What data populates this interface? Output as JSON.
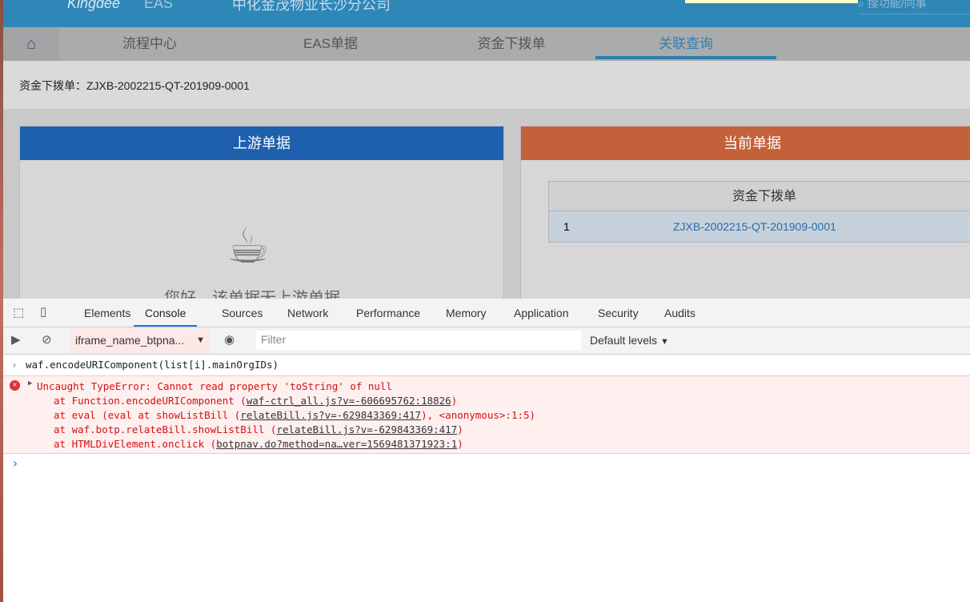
{
  "header": {
    "logo": "Kingdee",
    "product": "EAS",
    "org": "中化金茂物业长沙分公司",
    "search_placeholder": "搜功能/同事"
  },
  "nav": {
    "home": "⌂",
    "tabs": [
      "流程中心",
      "EAS单据",
      "资金下拨单",
      "关联查询"
    ],
    "active": 3
  },
  "breadcrumb": "资金下拨单：ZJXB-2002215-QT-201909-0001",
  "upstream": {
    "title": "上游单据",
    "empty_text": "您好，该单据无上游单据",
    "color": "#1e5fae"
  },
  "current": {
    "title": "当前单据",
    "color": "#c4603a",
    "table_header": "资金下拨单",
    "rows": [
      {
        "index": "1",
        "number": "ZJXB-2002215-QT-201909-0001"
      }
    ]
  },
  "devtools": {
    "tabs": [
      "Elements",
      "Console",
      "Sources",
      "Network",
      "Performance",
      "Memory",
      "Application",
      "Security",
      "Audits"
    ],
    "active_tab": "Console",
    "context": "iframe_name_btpna...",
    "filter_placeholder": "Filter",
    "levels": "Default levels",
    "input": "waf.encodeURIComponent(list[i].mainOrgIDs)",
    "error": {
      "message": "Uncaught TypeError: Cannot read property 'toString' of null",
      "stack": [
        {
          "pre": "at Function.encodeURIComponent (",
          "link": "waf-ctrl_all.js?v=-606695762:18826",
          "post": ")"
        },
        {
          "pre": "at eval (eval at showListBill (",
          "link": "relateBill.js?v=-629843369:417",
          "post": "), <anonymous>:1:5)"
        },
        {
          "pre": "at waf.botp.relateBill.showListBill (",
          "link": "relateBill.js?v=-629843369:417",
          "post": ")"
        },
        {
          "pre": "at HTMLDivElement.onclick (",
          "link": "botpnav.do?method=na…ver=1569481371923:1",
          "post": ")"
        }
      ]
    },
    "prompt": "›"
  }
}
